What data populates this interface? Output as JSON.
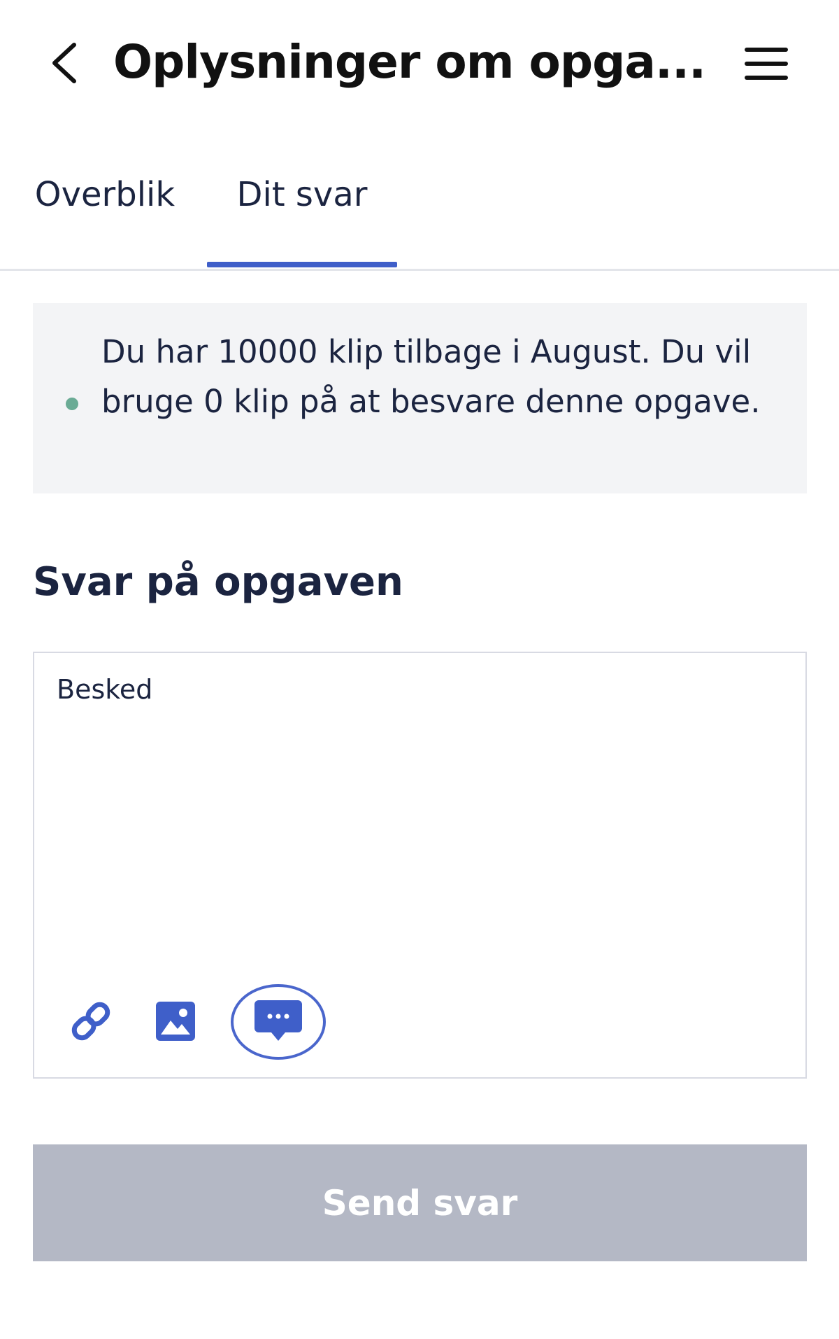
{
  "header": {
    "back_icon": "chevron-left-icon",
    "title": "Oplysninger om opga...",
    "menu_icon": "hamburger-menu-icon"
  },
  "tabs": [
    {
      "label": "Overblik",
      "active": false
    },
    {
      "label": "Dit svar",
      "active": true
    }
  ],
  "info": {
    "text": "Du har 10000 klip tilbage i August. Du vil bruge 0 klip på at besvare denne opgave.",
    "dot_color": "#6aab95"
  },
  "answer": {
    "heading": "Svar på opgaven",
    "placeholder": "Besked",
    "toolbar": [
      {
        "icon": "link-icon"
      },
      {
        "icon": "image-icon"
      },
      {
        "icon": "comment-icon",
        "highlighted": true
      }
    ]
  },
  "send_button": {
    "label": "Send svar",
    "disabled": true
  },
  "colors": {
    "accent": "#3f5fc9",
    "text": "#1b2440",
    "info_bg": "#f3f4f6",
    "button_disabled": "#b4b8c5"
  }
}
